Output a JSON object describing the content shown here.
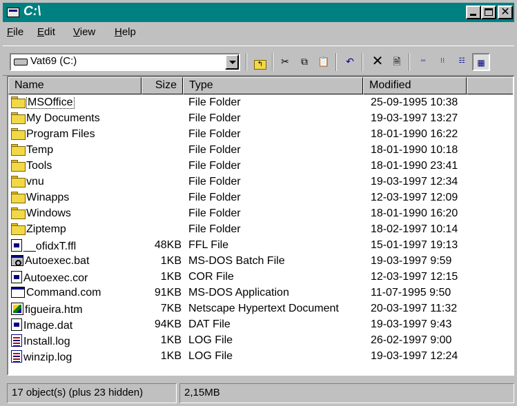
{
  "window": {
    "title": "C:\\"
  },
  "menu": [
    {
      "label": "File",
      "accel": "F",
      "rest": "ile"
    },
    {
      "label": "Edit",
      "accel": "E",
      "rest": "dit"
    },
    {
      "label": "View",
      "accel": "V",
      "rest": "iew"
    },
    {
      "label": "Help",
      "accel": "H",
      "rest": "elp"
    }
  ],
  "toolbar": {
    "drive": "Vat69 (C:)",
    "buttons": [
      "up-folder",
      "cut",
      "copy",
      "paste",
      "undo",
      "delete",
      "properties",
      "large-icons",
      "small-icons",
      "list",
      "details"
    ],
    "active_view": "details"
  },
  "columns": {
    "name": "Name",
    "size": "Size",
    "type": "Type",
    "modified": "Modified"
  },
  "files": [
    {
      "name": "MSOffice",
      "size": "",
      "type": "File Folder",
      "modified": "25-09-1995 10:38",
      "icon": "folder"
    },
    {
      "name": "My Documents",
      "size": "",
      "type": "File Folder",
      "modified": "19-03-1997 13:27",
      "icon": "folder"
    },
    {
      "name": "Program Files",
      "size": "",
      "type": "File Folder",
      "modified": "18-01-1990 16:22",
      "icon": "folder"
    },
    {
      "name": "Temp",
      "size": "",
      "type": "File Folder",
      "modified": "18-01-1990 10:18",
      "icon": "folder"
    },
    {
      "name": "Tools",
      "size": "",
      "type": "File Folder",
      "modified": "18-01-1990 23:41",
      "icon": "folder"
    },
    {
      "name": "vnu",
      "size": "",
      "type": "File Folder",
      "modified": "19-03-1997 12:34",
      "icon": "folder"
    },
    {
      "name": "Winapps",
      "size": "",
      "type": "File Folder",
      "modified": "12-03-1997 12:09",
      "icon": "folder"
    },
    {
      "name": "Windows",
      "size": "",
      "type": "File Folder",
      "modified": "18-01-1990 16:20",
      "icon": "folder"
    },
    {
      "name": "Ziptemp",
      "size": "",
      "type": "File Folder",
      "modified": "18-02-1997 10:14",
      "icon": "folder"
    },
    {
      "name": "__ofidxT.ffl",
      "size": "48KB",
      "type": "FFL File",
      "modified": "15-01-1997 19:13",
      "icon": "file"
    },
    {
      "name": "Autoexec.bat",
      "size": "1KB",
      "type": "MS-DOS Batch File",
      "modified": "19-03-1997 9:59",
      "icon": "bat"
    },
    {
      "name": "Autoexec.cor",
      "size": "1KB",
      "type": "COR File",
      "modified": "12-03-1997 12:15",
      "icon": "file"
    },
    {
      "name": "Command.com",
      "size": "91KB",
      "type": "MS-DOS Application",
      "modified": "11-07-1995 9:50",
      "icon": "app"
    },
    {
      "name": "figueira.htm",
      "size": "7KB",
      "type": "Netscape Hypertext Document",
      "modified": "20-03-1997 11:32",
      "icon": "htm"
    },
    {
      "name": "Image.dat",
      "size": "94KB",
      "type": "DAT File",
      "modified": "19-03-1997 9:43",
      "icon": "file"
    },
    {
      "name": "Install.log",
      "size": "1KB",
      "type": "LOG File",
      "modified": "26-02-1997 9:00",
      "icon": "log"
    },
    {
      "name": "winzip.log",
      "size": "1KB",
      "type": "LOG File",
      "modified": "19-03-1997 12:24",
      "icon": "log"
    }
  ],
  "status": {
    "objects": "17 object(s) (plus 23 hidden)",
    "size": "2,15MB"
  }
}
